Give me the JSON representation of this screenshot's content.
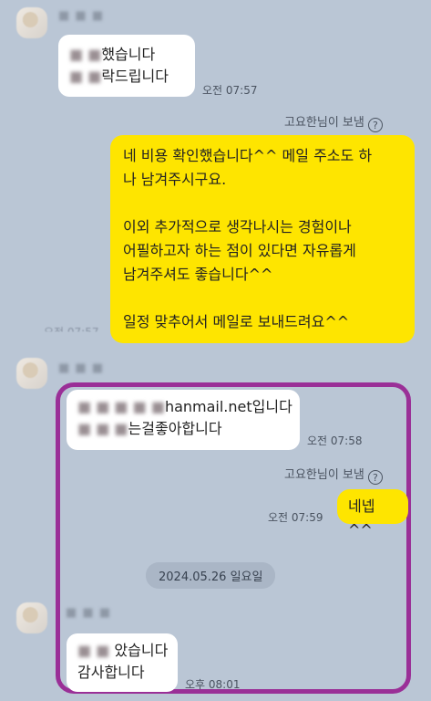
{
  "chat": {
    "msg1": {
      "line1": "■ ■했습니다",
      "line2": "■ ■ 락드립니다",
      "time": "오전 07:57"
    },
    "read_by_1": "고요한님이 보냄",
    "my_msg": {
      "line1": "네 비용 확인했습니다^^ 메일 주소도 하",
      "line2": "나 남겨주시구요.",
      "line3": "이외 추가적으로 생각나시는 경험이나",
      "line4": "어필하고자 하는 점이 있다면 자유롭게",
      "line5": "남겨주셔도 좋습니다^^",
      "line6": "일정 맞추어서 메일로 보내드려요^^"
    },
    "hidden_time": "오전 07:57",
    "msg2": {
      "line1_redacted": "■ ■ ■ ■ ■",
      "line1_visible": "hanmail.net입니다",
      "line2_redacted": "■ ■ ■",
      "line2_visible": "는걸좋아합니다",
      "time": "오전 07:58"
    },
    "read_by_2": "고요한님이 보냄",
    "my_reply": {
      "text": "네넵^^",
      "time": "오전 07:59"
    },
    "date_divider": "2024.05.26 일요일",
    "msg3": {
      "line1_redacted": "■ ■ ",
      "line1_visible": "았습니다",
      "line2": "감사합니다",
      "time": "오후 08:01"
    },
    "redacted_name": "■ ■ ■"
  },
  "icons": {
    "question": "?"
  },
  "colors": {
    "background": "#bac6d5",
    "my_bubble": "#fee500",
    "other_bubble": "#ffffff",
    "highlight": "#9a2f97"
  }
}
